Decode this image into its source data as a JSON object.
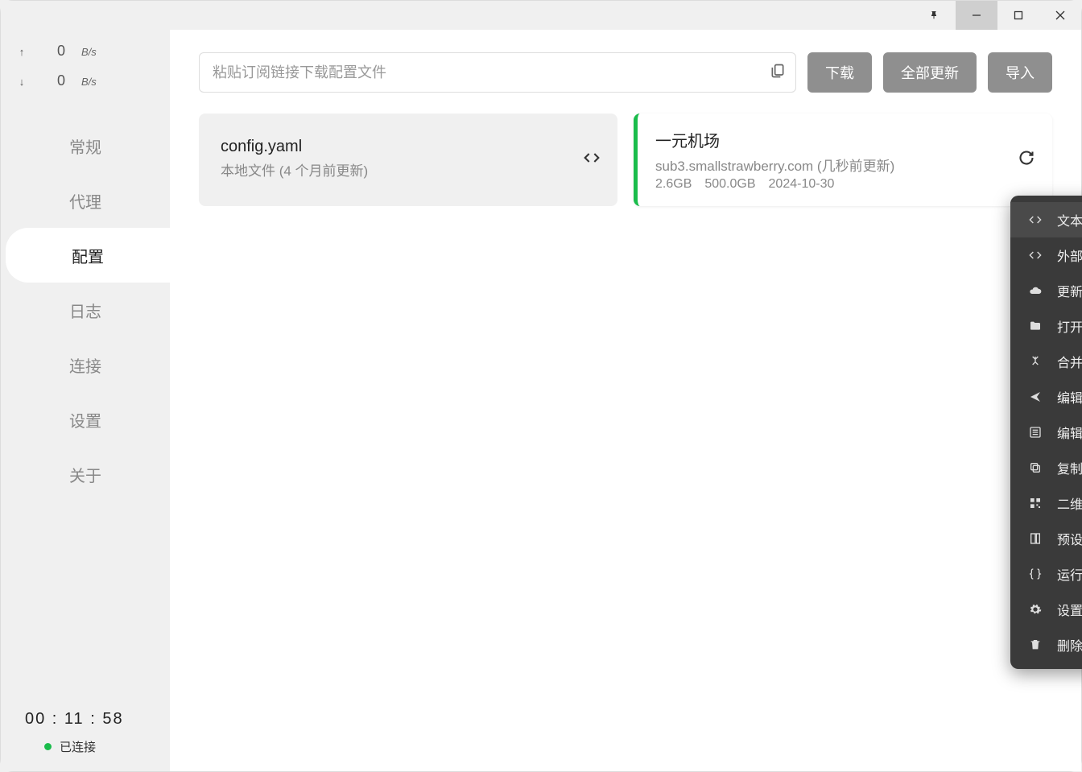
{
  "speed": {
    "up_value": "0",
    "up_unit": "B/s",
    "down_value": "0",
    "down_unit": "B/s"
  },
  "nav": {
    "items": [
      "常规",
      "代理",
      "配置",
      "日志",
      "连接",
      "设置",
      "关于"
    ],
    "active_index": 2
  },
  "footer": {
    "timer": "00 : 11 : 58",
    "status": "已连接"
  },
  "toolbar": {
    "placeholder": "粘贴订阅链接下载配置文件",
    "download": "下载",
    "update_all": "全部更新",
    "import": "导入"
  },
  "profiles": [
    {
      "name": "config.yaml",
      "subtitle": "本地文件 (4 个月前更新)",
      "meta": [],
      "active": false,
      "action_icon": "code"
    },
    {
      "name": "一元机场",
      "subtitle": "sub3.smallstrawberry.com (几秒前更新)",
      "meta": [
        "2.6GB",
        "500.0GB",
        "2024-10-30"
      ],
      "active": true,
      "action_icon": "refresh"
    }
  ],
  "context_menu": [
    {
      "icon": "code",
      "label": "文本编辑",
      "highlight": true
    },
    {
      "icon": "code",
      "label": "外部编辑"
    },
    {
      "icon": "cloud",
      "label": "更新配置"
    },
    {
      "icon": "folder",
      "label": "打开位置"
    },
    {
      "icon": "merge",
      "label": "合并配置"
    },
    {
      "icon": "send",
      "label": "编辑策略"
    },
    {
      "icon": "list",
      "label": "编辑规则"
    },
    {
      "icon": "copy",
      "label": "复制配置"
    },
    {
      "icon": "qr",
      "label": "二维码链"
    },
    {
      "icon": "preset",
      "label": "预设配置"
    },
    {
      "icon": "braces",
      "label": "运行脚本"
    },
    {
      "icon": "gear",
      "label": "设置订阅"
    },
    {
      "icon": "trash",
      "label": "删除配置"
    }
  ]
}
